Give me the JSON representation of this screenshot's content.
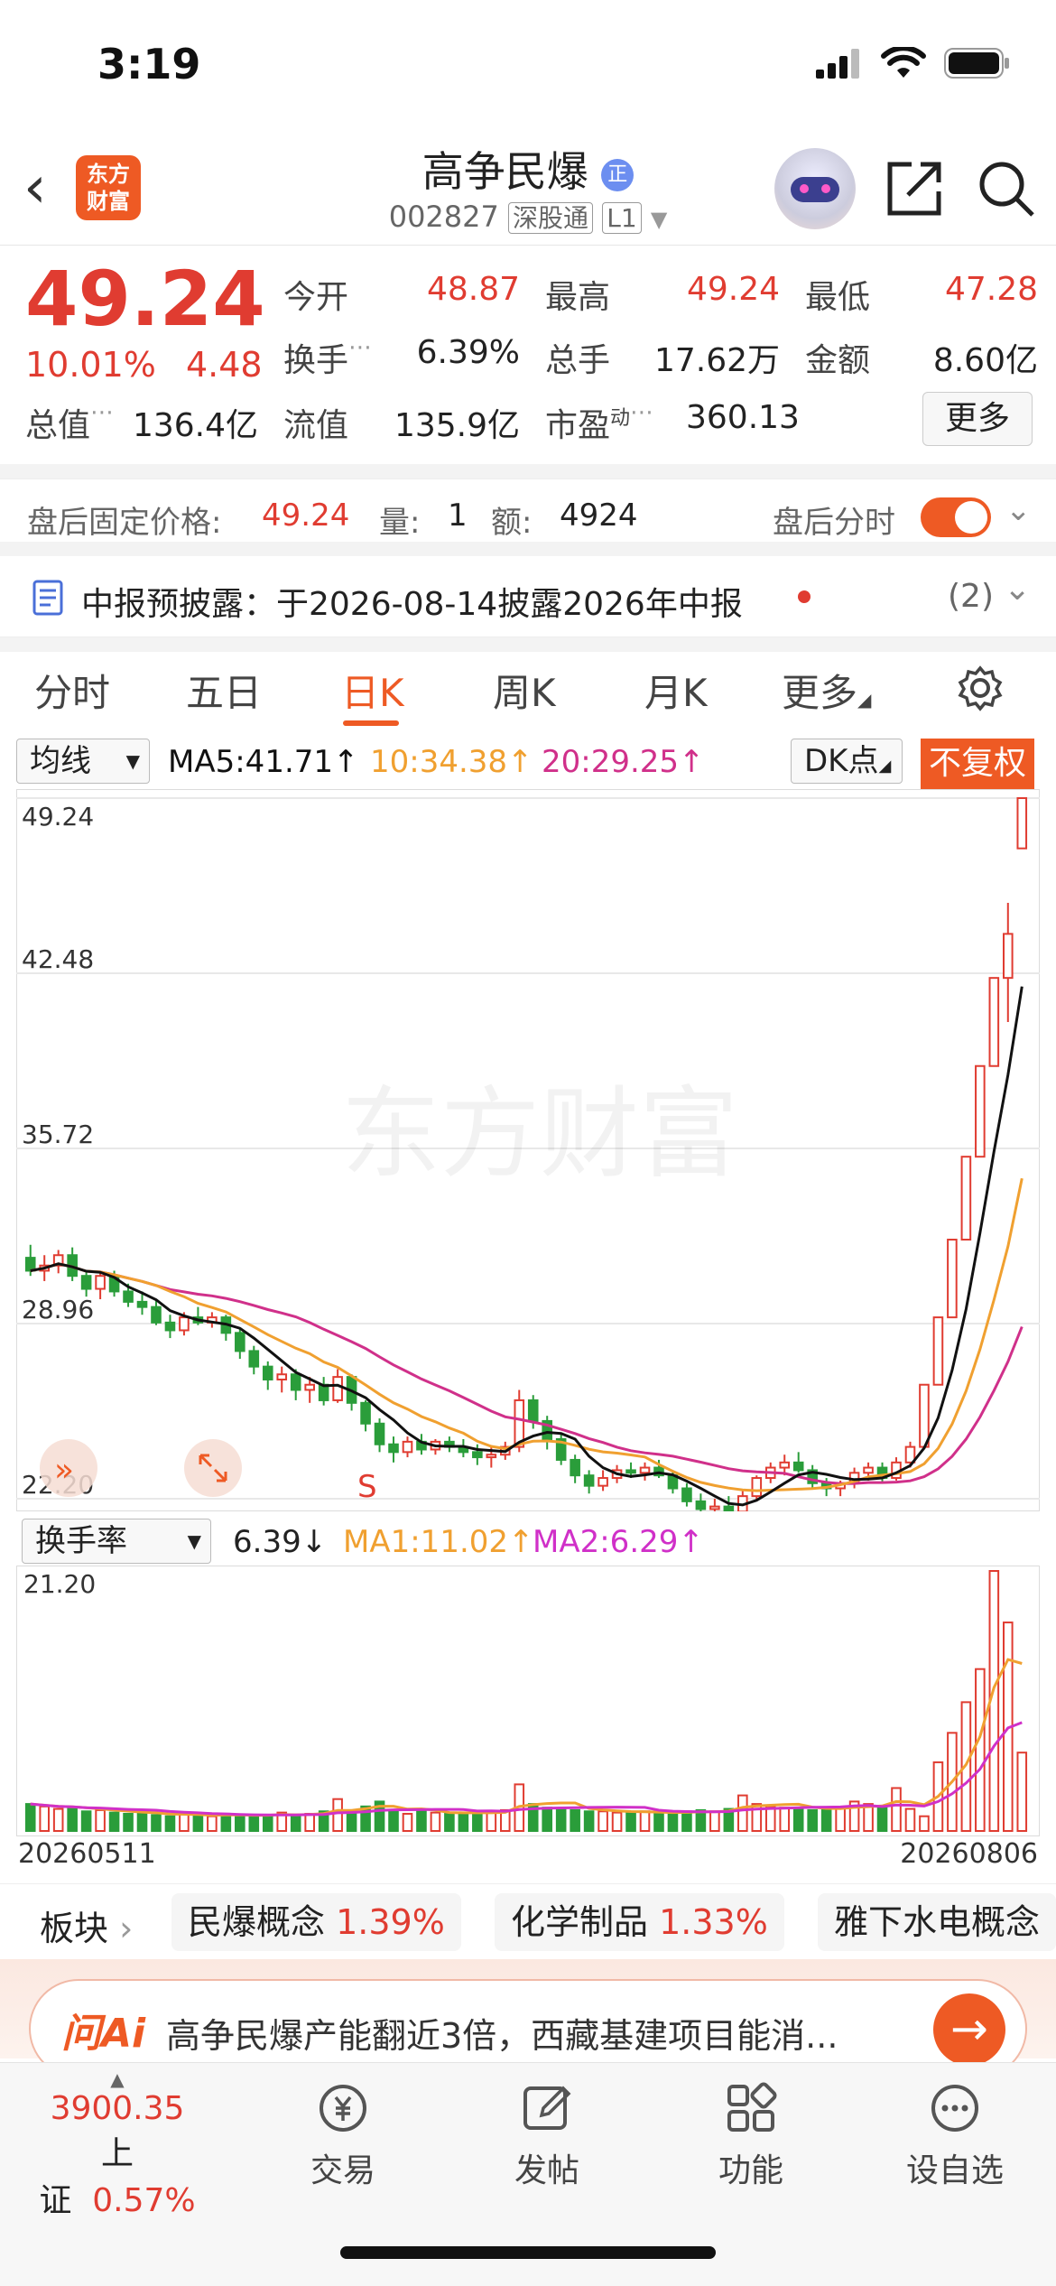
{
  "status_bar": {
    "time": "3:19"
  },
  "header": {
    "back": "‹",
    "logo_line1": "东方",
    "logo_line2": "财富",
    "stock_name": "高争民爆",
    "name_badge": "正",
    "stock_code": "002827",
    "tag_connect": "深股通",
    "tag_level": "L1"
  },
  "quote": {
    "price": "49.24",
    "change_pct": "10.01%",
    "change_amt": "4.48",
    "open_label": "今开",
    "open": "48.87",
    "high_label": "最高",
    "high": "49.24",
    "low_label": "最低",
    "low": "47.28",
    "turnover_label": "换手",
    "turnover": "6.39%",
    "volume_label": "总手",
    "volume": "17.62万",
    "amount_label": "金额",
    "amount": "8.60亿",
    "mktcap_label": "总值",
    "mktcap": "136.4亿",
    "float_label": "流值",
    "float": "135.9亿",
    "pe_label": "市盈",
    "pe_sup": "动",
    "pe": "360.13",
    "more": "更多"
  },
  "after_hours": {
    "label": "盘后固定价格:",
    "price": "49.24",
    "vol_label": "量:",
    "vol": "1",
    "amt_label": "额:",
    "amt": "4924",
    "timeshare_label": "盘后分时"
  },
  "disclosure": {
    "text": "中报预披露：于2026-08-14披露2026年中报",
    "count": "(2)"
  },
  "tabs": [
    "分时",
    "五日",
    "日K",
    "周K",
    "月K",
    "更多"
  ],
  "ma_row": {
    "dropdown": "均线",
    "ma5": "MA5:41.71↑",
    "ma10": "10:34.38↑",
    "ma20": "20:29.25↑",
    "dk": "DK点",
    "fuquan": "不复权"
  },
  "colors": {
    "accent": "#ee5a24",
    "up": "#e03c31",
    "down": "#2a9d3a",
    "ma5": "#111111",
    "ma10": "#f0a030",
    "ma20": "#d0308a"
  },
  "chart_data": [
    {
      "type": "candlestick",
      "y_ticks": [
        "49.24",
        "42.48",
        "35.72",
        "28.96",
        "22.20"
      ],
      "ylim": [
        22.2,
        49.24
      ],
      "marker": "S",
      "ohlc": [
        [
          31.5,
          32.0,
          30.8,
          31.0
        ],
        [
          31.0,
          31.6,
          30.6,
          31.2
        ],
        [
          31.2,
          31.8,
          30.9,
          31.6
        ],
        [
          31.6,
          31.9,
          30.6,
          30.8
        ],
        [
          30.8,
          31.0,
          30.0,
          30.3
        ],
        [
          30.3,
          31.0,
          29.9,
          30.8
        ],
        [
          30.8,
          31.0,
          30.0,
          30.2
        ],
        [
          30.2,
          30.5,
          29.6,
          29.8
        ],
        [
          29.8,
          30.2,
          29.3,
          29.6
        ],
        [
          29.6,
          29.9,
          28.9,
          29.0
        ],
        [
          29.0,
          29.3,
          28.4,
          28.7
        ],
        [
          28.7,
          29.4,
          28.5,
          29.2
        ],
        [
          29.2,
          29.6,
          28.9,
          29.0
        ],
        [
          29.0,
          29.4,
          28.8,
          29.2
        ],
        [
          29.2,
          29.3,
          28.3,
          28.6
        ],
        [
          28.6,
          28.8,
          27.6,
          27.9
        ],
        [
          27.9,
          28.1,
          27.0,
          27.3
        ],
        [
          27.3,
          27.5,
          26.4,
          26.8
        ],
        [
          26.8,
          27.3,
          26.3,
          27.0
        ],
        [
          27.0,
          27.2,
          26.0,
          26.4
        ],
        [
          26.4,
          26.9,
          25.9,
          26.6
        ],
        [
          26.6,
          26.9,
          25.8,
          26.0
        ],
        [
          26.0,
          27.2,
          25.9,
          26.9
        ],
        [
          26.9,
          27.0,
          25.6,
          25.9
        ],
        [
          25.9,
          26.0,
          24.8,
          25.1
        ],
        [
          25.1,
          25.3,
          24.0,
          24.3
        ],
        [
          24.3,
          24.6,
          23.6,
          24.0
        ],
        [
          24.0,
          24.6,
          23.8,
          24.4
        ],
        [
          24.4,
          24.7,
          23.9,
          24.1
        ],
        [
          24.1,
          24.5,
          23.9,
          24.4
        ],
        [
          24.4,
          24.6,
          24.0,
          24.2
        ],
        [
          24.2,
          24.5,
          23.8,
          24.0
        ],
        [
          24.0,
          24.3,
          23.5,
          23.8
        ],
        [
          23.8,
          24.2,
          23.4,
          23.9
        ],
        [
          23.9,
          24.4,
          23.7,
          24.2
        ],
        [
          24.2,
          26.4,
          24.0,
          26.0
        ],
        [
          26.0,
          26.2,
          24.9,
          25.2
        ],
        [
          25.2,
          25.4,
          24.1,
          24.5
        ],
        [
          24.5,
          24.7,
          23.5,
          23.7
        ],
        [
          23.7,
          23.9,
          22.8,
          23.1
        ],
        [
          23.1,
          23.3,
          22.4,
          22.7
        ],
        [
          22.7,
          23.3,
          22.5,
          23.0
        ],
        [
          23.0,
          23.5,
          22.8,
          23.3
        ],
        [
          23.3,
          23.6,
          23.0,
          23.2
        ],
        [
          23.2,
          23.6,
          22.9,
          23.4
        ],
        [
          23.4,
          23.7,
          23.0,
          23.1
        ],
        [
          23.1,
          23.3,
          22.4,
          22.6
        ],
        [
          22.6,
          22.8,
          21.9,
          22.1
        ],
        [
          22.1,
          22.4,
          21.6,
          21.8
        ],
        [
          21.8,
          22.2,
          21.5,
          21.9
        ],
        [
          21.9,
          22.3,
          21.6,
          21.7
        ],
        [
          21.7,
          22.5,
          21.6,
          22.3
        ],
        [
          22.3,
          23.1,
          22.1,
          23.0
        ],
        [
          23.0,
          23.6,
          22.8,
          23.4
        ],
        [
          23.4,
          23.9,
          23.1,
          23.6
        ],
        [
          23.6,
          24.0,
          23.2,
          23.3
        ],
        [
          23.3,
          23.5,
          22.6,
          22.8
        ],
        [
          22.8,
          23.0,
          22.3,
          22.6
        ],
        [
          22.6,
          22.9,
          22.3,
          22.8
        ],
        [
          22.8,
          23.4,
          22.6,
          23.2
        ],
        [
          23.2,
          23.6,
          22.9,
          23.4
        ],
        [
          23.4,
          23.6,
          22.8,
          23.0
        ],
        [
          23.0,
          23.8,
          22.9,
          23.6
        ],
        [
          23.6,
          24.4,
          23.4,
          24.2
        ],
        [
          24.2,
          26.6,
          24.2,
          26.6
        ],
        [
          26.6,
          29.2,
          26.6,
          29.2
        ],
        [
          29.2,
          32.2,
          29.2,
          32.2
        ],
        [
          32.2,
          35.4,
          32.2,
          35.4
        ],
        [
          35.4,
          38.9,
          35.4,
          38.9
        ],
        [
          38.9,
          42.3,
          38.9,
          42.3
        ],
        [
          42.3,
          45.2,
          40.6,
          44.0
        ],
        [
          47.3,
          49.24,
          47.28,
          49.24
        ]
      ],
      "ma5_end": "41.71",
      "ma10_end": "34.38",
      "ma20_end": "29.25"
    },
    {
      "type": "bar",
      "title": "换手率",
      "ylim": [
        0,
        21.2
      ],
      "y_ticks": [
        "21.20"
      ],
      "x_labels": [
        "20260511",
        "20260806"
      ],
      "values": [
        2.2,
        2.0,
        1.8,
        1.9,
        1.6,
        1.7,
        1.5,
        1.4,
        1.5,
        1.3,
        1.2,
        1.4,
        1.3,
        1.2,
        1.4,
        1.3,
        1.2,
        1.3,
        1.5,
        1.3,
        1.4,
        1.6,
        2.6,
        1.5,
        2.0,
        2.4,
        1.6,
        1.4,
        1.6,
        1.5,
        1.4,
        1.5,
        1.4,
        1.6,
        1.7,
        3.8,
        2.2,
        1.9,
        1.8,
        1.7,
        1.6,
        1.6,
        1.5,
        1.5,
        1.6,
        1.5,
        1.4,
        1.6,
        1.7,
        1.6,
        1.8,
        2.9,
        2.2,
        2.0,
        1.9,
        1.9,
        1.7,
        1.7,
        1.9,
        2.4,
        2.2,
        2.0,
        3.5,
        1.8,
        1.2,
        5.6,
        8.0,
        10.5,
        13.2,
        21.2,
        17.0,
        6.39
      ]
    }
  ],
  "vol_row": {
    "dropdown": "换手率",
    "value": "6.39↓",
    "ma1": "MA1:11.02↑",
    "ma2": "MA2:6.29↑"
  },
  "sectors": {
    "label": "板块",
    "items": [
      {
        "name": "民爆概念",
        "pct": "1.39%"
      },
      {
        "name": "化学制品",
        "pct": "1.33%"
      },
      {
        "name": "雅下水电概念",
        "pct": ""
      }
    ]
  },
  "ai": {
    "logo": "问Ai",
    "text": "高争民爆产能翻近3倍，西藏基建项目能消...",
    "go": "→"
  },
  "bottom_nav": {
    "index_value": "3900.35",
    "index_name": "上证",
    "index_pct": "0.57%",
    "items": [
      "交易",
      "发帖",
      "功能",
      "设自选"
    ]
  }
}
